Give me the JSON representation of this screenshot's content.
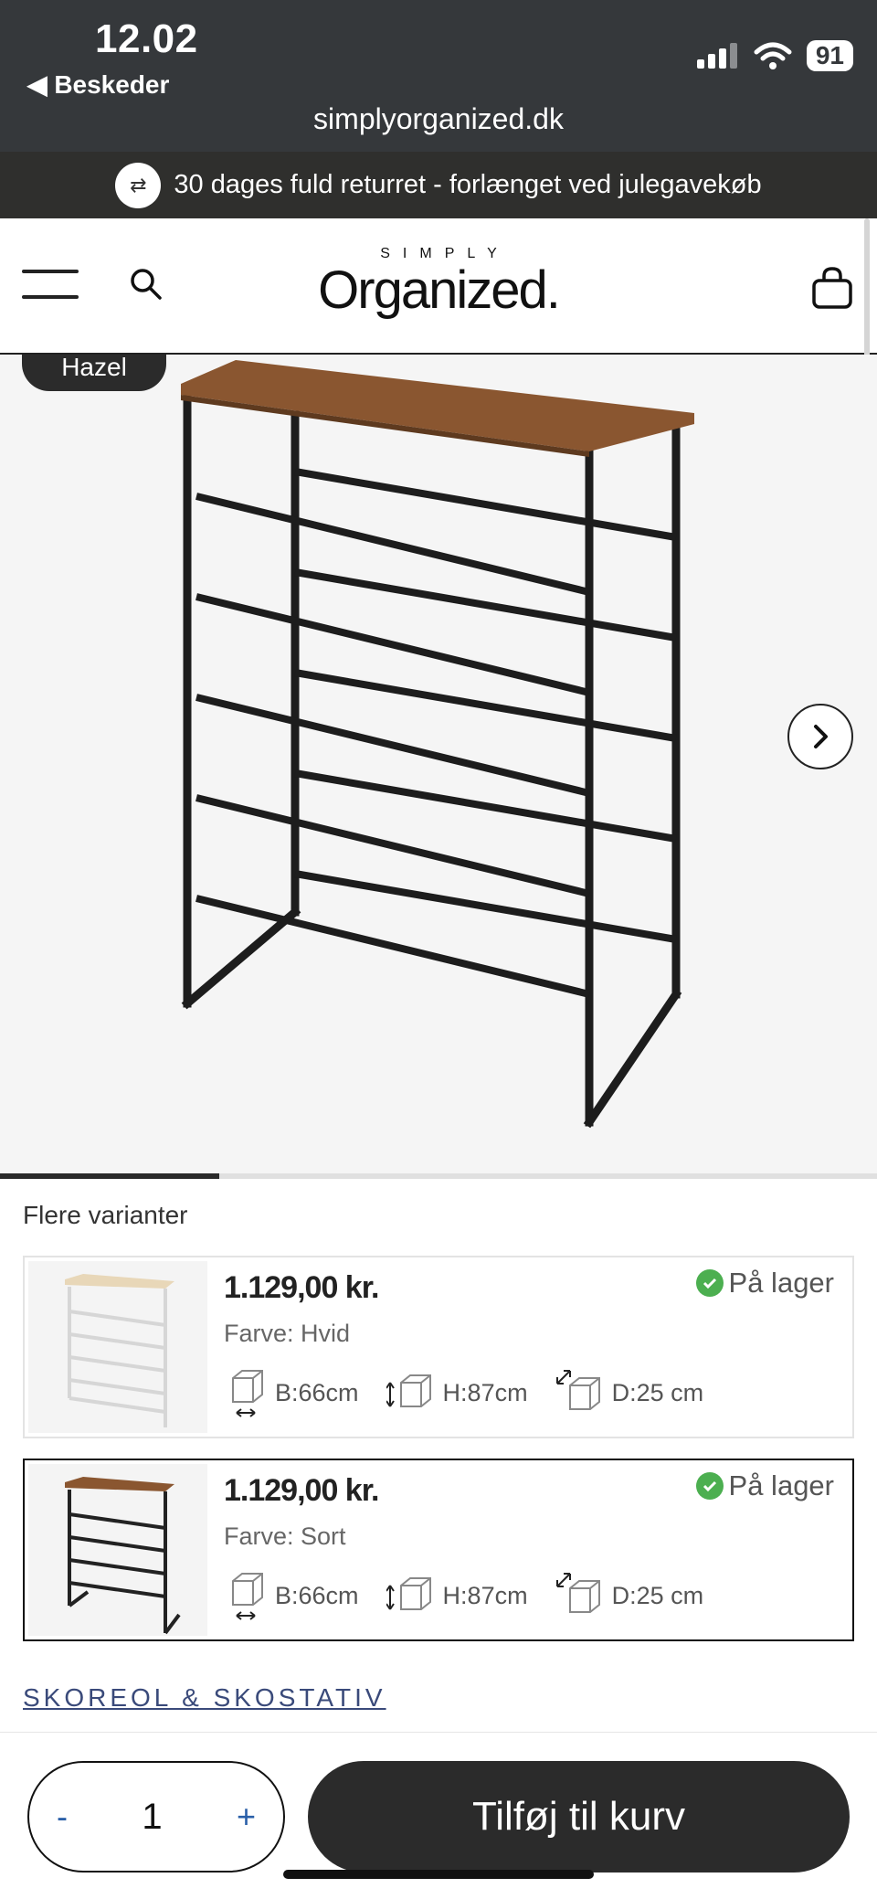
{
  "status_bar": {
    "time": "12.02",
    "back_label": "◀ Beskeder",
    "url": "simplyorganized.dk",
    "battery": "91"
  },
  "promo_banner": {
    "text": "30 dages fuld returret - forlænget ved julegavekøb"
  },
  "header": {
    "logo_top": "SIMPLY",
    "logo_main": "Organized."
  },
  "gallery": {
    "tag": "Hazel",
    "progress": 0.25
  },
  "variants": {
    "title": "Flere varianter",
    "items": [
      {
        "price": "1.129,00 kr.",
        "stock": "På lager",
        "color": "Farve: Hvid",
        "width": "B:66cm",
        "height": "H:87cm",
        "depth": "D:25 cm"
      },
      {
        "price": "1.129,00 kr.",
        "stock": "På lager",
        "color": "Farve: Sort",
        "width": "B:66cm",
        "height": "H:87cm",
        "depth": "D:25 cm"
      }
    ]
  },
  "category_link": "SKOREOL & SKOSTATIV",
  "cart_bar": {
    "minus": "-",
    "quantity": "1",
    "plus": "+",
    "add_label": "Tilføj til kurv"
  },
  "colors": {
    "dark": "#2b2b2b",
    "stock_green": "#4caf50",
    "wood": "#8a5630",
    "link": "#3a4a7a"
  }
}
